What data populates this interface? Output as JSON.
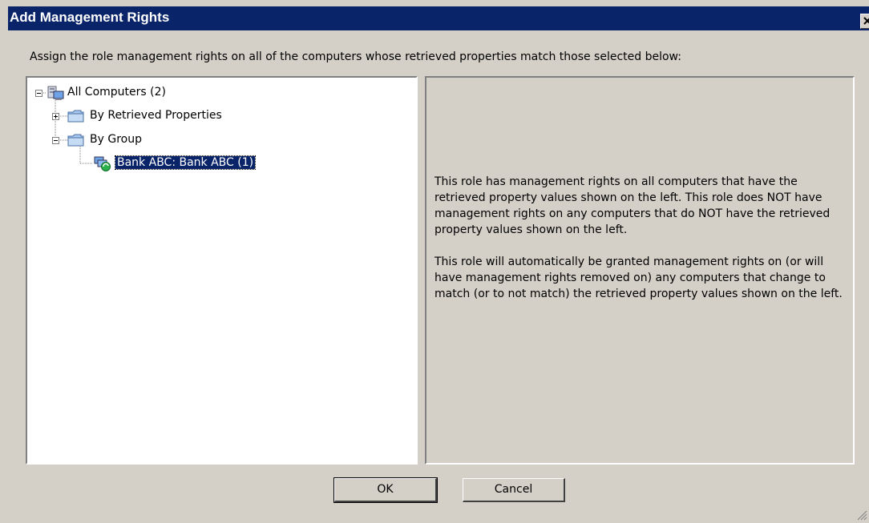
{
  "window": {
    "title": "Add Management Rights"
  },
  "instruction": "Assign the role management rights on all of the computers whose retrieved properties match those selected below:",
  "tree": {
    "root": {
      "label": "All Computers (2)",
      "icon": "computers-icon",
      "expanded": true
    },
    "children": [
      {
        "label": "By Retrieved Properties",
        "icon": "folder-icon",
        "expanded": false
      },
      {
        "label": "By Group",
        "icon": "folder-icon",
        "expanded": true,
        "children": [
          {
            "label": "Bank ABC: Bank ABC (1)",
            "icon": "computer-group-sync-icon",
            "selected": true
          }
        ]
      }
    ]
  },
  "info": {
    "paragraph1": "This role has management rights on all computers that have the retrieved property values shown on the left. This role does NOT have management rights on any computers that do NOT have the retrieved property values shown on the left.",
    "paragraph2": "This role will automatically be granted management rights on (or will have management rights removed on) any computers that change to match (or to not match) the retrieved property values shown on the left."
  },
  "buttons": {
    "ok_label": "OK",
    "cancel_label": "Cancel"
  },
  "colors": {
    "titlebar": "#0a246a",
    "dialog_bg": "#d4d0c8",
    "selection": "#0a246a"
  }
}
